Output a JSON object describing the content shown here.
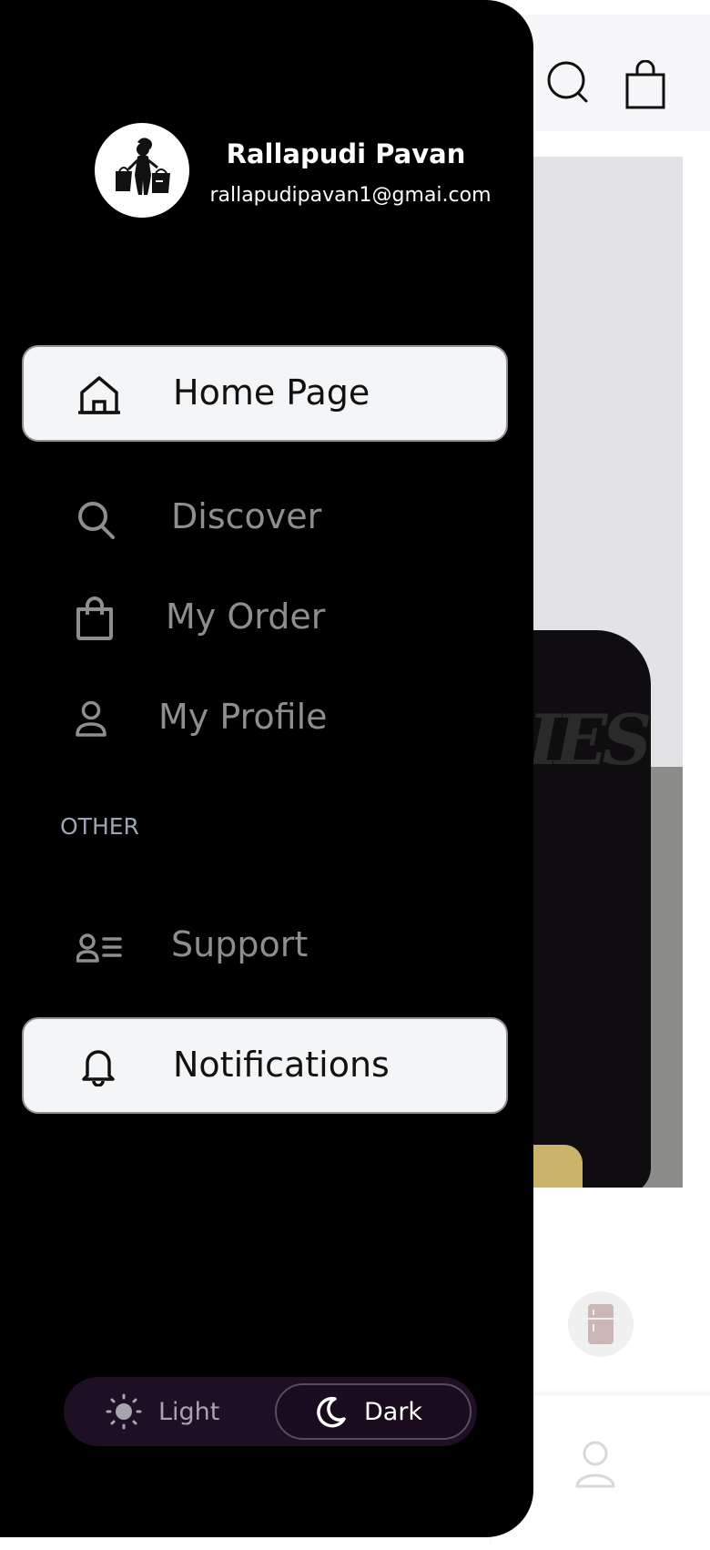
{
  "user": {
    "name": "Rallapudi Pavan",
    "email": "rallapudipavan1@gmai.com"
  },
  "menu": {
    "items": [
      {
        "label": "Home Page",
        "icon": "home-icon",
        "active": true
      },
      {
        "label": "Discover",
        "icon": "search-icon",
        "active": false
      },
      {
        "label": "My Order",
        "icon": "shopping-bag-icon",
        "active": false
      },
      {
        "label": "My Profile",
        "icon": "user-icon",
        "active": false
      }
    ],
    "section_other": "OTHER",
    "other_items": [
      {
        "label": "Support",
        "icon": "contact-list-icon",
        "active": false
      },
      {
        "label": "Notifications",
        "icon": "bell-icon",
        "active": true
      }
    ]
  },
  "theme": {
    "light_label": "Light",
    "dark_label": "Dark",
    "selected": "Dark"
  },
  "background": {
    "hero_text": "IES"
  },
  "colors": {
    "drawer_bg": "#000000",
    "active_item_bg": "#f4f5f7",
    "inactive_text": "#8e8e8e",
    "section_label": "#9aa6b8",
    "toggle_bg": "#1f0f24"
  }
}
